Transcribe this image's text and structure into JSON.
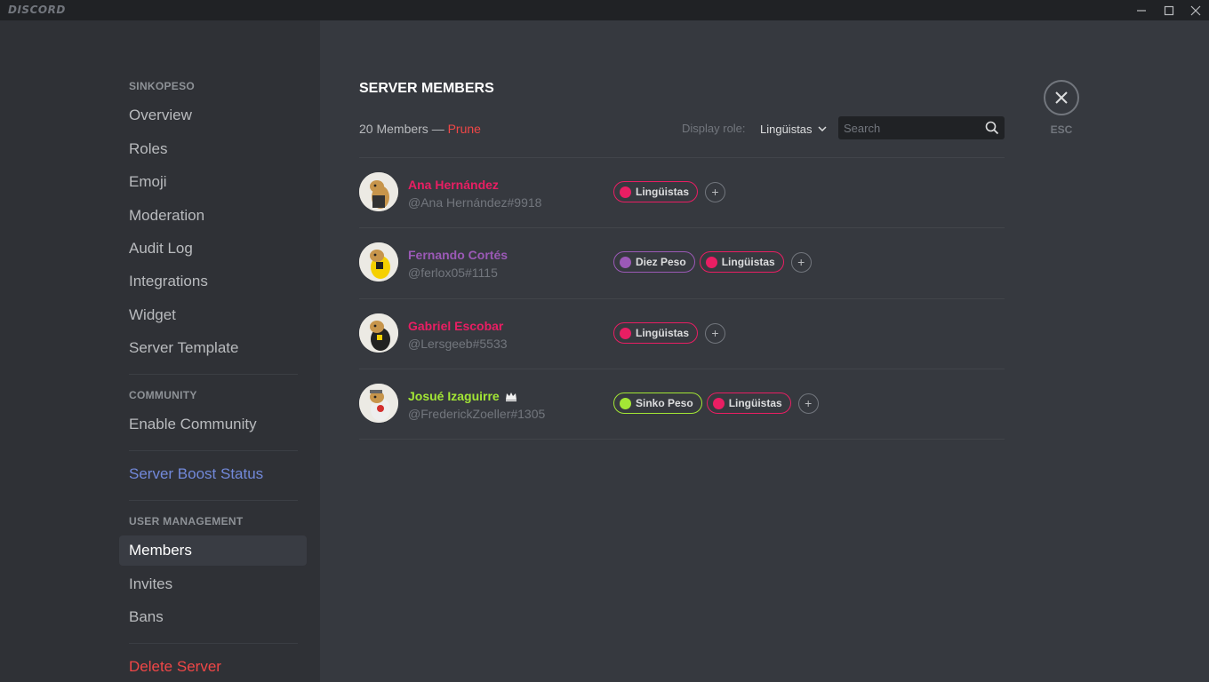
{
  "app": {
    "logo": "DISCORD"
  },
  "window": {
    "minimize": "minimize",
    "maximize": "maximize",
    "close": "close"
  },
  "sidebar": {
    "server_header": "SINKOPESO",
    "server_items": [
      "Overview",
      "Roles",
      "Emoji",
      "Moderation",
      "Audit Log",
      "Integrations",
      "Widget",
      "Server Template"
    ],
    "community_header": "COMMUNITY",
    "community_item": "Enable Community",
    "boost_item": "Server Boost Status",
    "user_mgmt_header": "USER MANAGEMENT",
    "user_mgmt_items": [
      "Members",
      "Invites",
      "Bans"
    ],
    "selected": "Members",
    "delete_item": "Delete Server"
  },
  "main": {
    "title": "SERVER MEMBERS",
    "member_count": "20 Members —",
    "prune": "Prune",
    "display_role_label": "Display role:",
    "display_role_value": "Lingüistas",
    "search_placeholder": "Search",
    "esc_label": "ESC"
  },
  "colors": {
    "linguistas": "#e91e63",
    "diez_peso": "#9b59b6",
    "sinko_peso": "#a3e635",
    "name_pink": "#e91e63",
    "name_purple": "#9b59b6",
    "name_green": "#a3e635"
  },
  "members": [
    {
      "name": "Ana Hernández",
      "tag": "@Ana Hernández#9918",
      "name_color": "#e91e63",
      "owner": false,
      "roles": [
        {
          "label": "Lingüistas",
          "color": "#e91e63"
        }
      ]
    },
    {
      "name": "Fernando Cortés",
      "tag": "@ferlox05#1115",
      "name_color": "#9b59b6",
      "owner": false,
      "roles": [
        {
          "label": "Diez Peso",
          "color": "#9b59b6"
        },
        {
          "label": "Lingüistas",
          "color": "#e91e63"
        }
      ]
    },
    {
      "name": "Gabriel Escobar",
      "tag": "@Lersgeeb#5533",
      "name_color": "#e91e63",
      "owner": false,
      "roles": [
        {
          "label": "Lingüistas",
          "color": "#e91e63"
        }
      ]
    },
    {
      "name": "Josué Izaguirre",
      "tag": "@FrederickZoeller#1305",
      "name_color": "#a3e635",
      "owner": true,
      "roles": [
        {
          "label": "Sinko Peso",
          "color": "#a3e635"
        },
        {
          "label": "Lingüistas",
          "color": "#e91e63"
        }
      ]
    }
  ]
}
